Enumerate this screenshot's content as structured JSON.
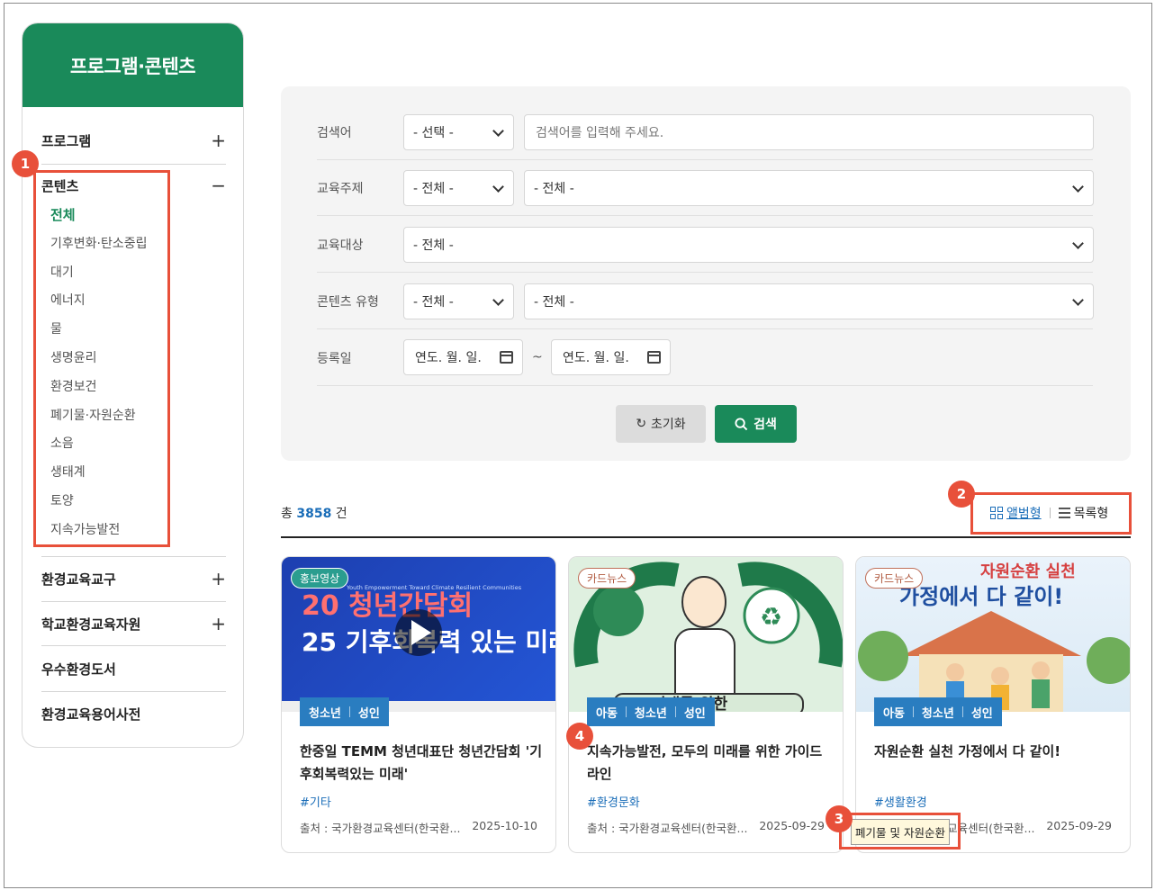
{
  "sidebar": {
    "title": "프로그램·콘텐츠",
    "groups": [
      {
        "label": "프로그램",
        "toggle": "+"
      },
      {
        "label": "콘텐츠",
        "toggle": "−"
      },
      {
        "label": "환경교육교구",
        "toggle": "+"
      },
      {
        "label": "학교환경교육자원",
        "toggle": "+"
      },
      {
        "label": "우수환경도서",
        "toggle": ""
      },
      {
        "label": "환경교육용어사전",
        "toggle": ""
      }
    ],
    "content_items": [
      "전체",
      "기후변화·탄소중립",
      "대기",
      "에너지",
      "물",
      "생명윤리",
      "환경보건",
      "폐기물·자원순환",
      "소음",
      "생태계",
      "토양",
      "지속가능발전"
    ]
  },
  "search": {
    "keyword_label": "검색어",
    "keyword_select": "- 선택 -",
    "keyword_placeholder": "검색어를 입력해 주세요.",
    "topic_label": "교육주제",
    "topic_select1": "- 전체 -",
    "topic_select2": "- 전체 -",
    "target_label": "교육대상",
    "target_select": "- 전체 -",
    "type_label": "콘텐츠 유형",
    "type_select1": "- 전체 -",
    "type_select2": "- 전체 -",
    "date_label": "등록일",
    "date_from": "연도. 월. 일.",
    "date_to": "연도. 월. 일.",
    "date_sep": "~",
    "reset_label": "초기화",
    "search_label": "검색"
  },
  "results": {
    "total_prefix": "총",
    "total_count": "3858",
    "total_suffix": "건",
    "view_album": "앨범형",
    "view_list": "목록형"
  },
  "cards": [
    {
      "category": "홍보영상",
      "thumb_text_1": "20 청년간담회",
      "thumb_text_2": "25 기후회복력 있는 미래",
      "thumb_small": "Youth Empowerment Toward Climate Resilient Communities",
      "tags": [
        "청소년",
        "성인"
      ],
      "title": "한중일 TEMM 청년대표단 청년간담회 '기후회복력있는 미래'",
      "hashtag": "#기타",
      "source": "출처 : 국가환경교육센터(한국환...",
      "date": "2025-10-10"
    },
    {
      "category": "카드뉴스",
      "thumb_text_1": "미래를 위한",
      "tags": [
        "아동",
        "청소년",
        "성인"
      ],
      "title": "지속가능발전, 모두의 미래를 위한 가이드라인",
      "hashtag": "#환경문화",
      "source": "출처 : 국가환경교육센터(한국환...",
      "date": "2025-09-29"
    },
    {
      "category": "카드뉴스",
      "thumb_text_1": "자원순환 실천",
      "thumb_text_2": "가정에서 다 같이!",
      "tags": [
        "아동",
        "청소년",
        "성인"
      ],
      "title": "자원순환 실천 가정에서 다 같이!",
      "hashtag": "#생활환경",
      "source": "출처 : 국가환경교육센터(한국환...",
      "date": "2025-09-29"
    }
  ],
  "tooltip": "폐기물 및 자원순환",
  "annotations": [
    "1",
    "2",
    "3",
    "4"
  ],
  "colors": {
    "brand_green": "#1a8a5a",
    "accent_blue": "#1a6db8",
    "annotation_red": "#e8503a"
  }
}
